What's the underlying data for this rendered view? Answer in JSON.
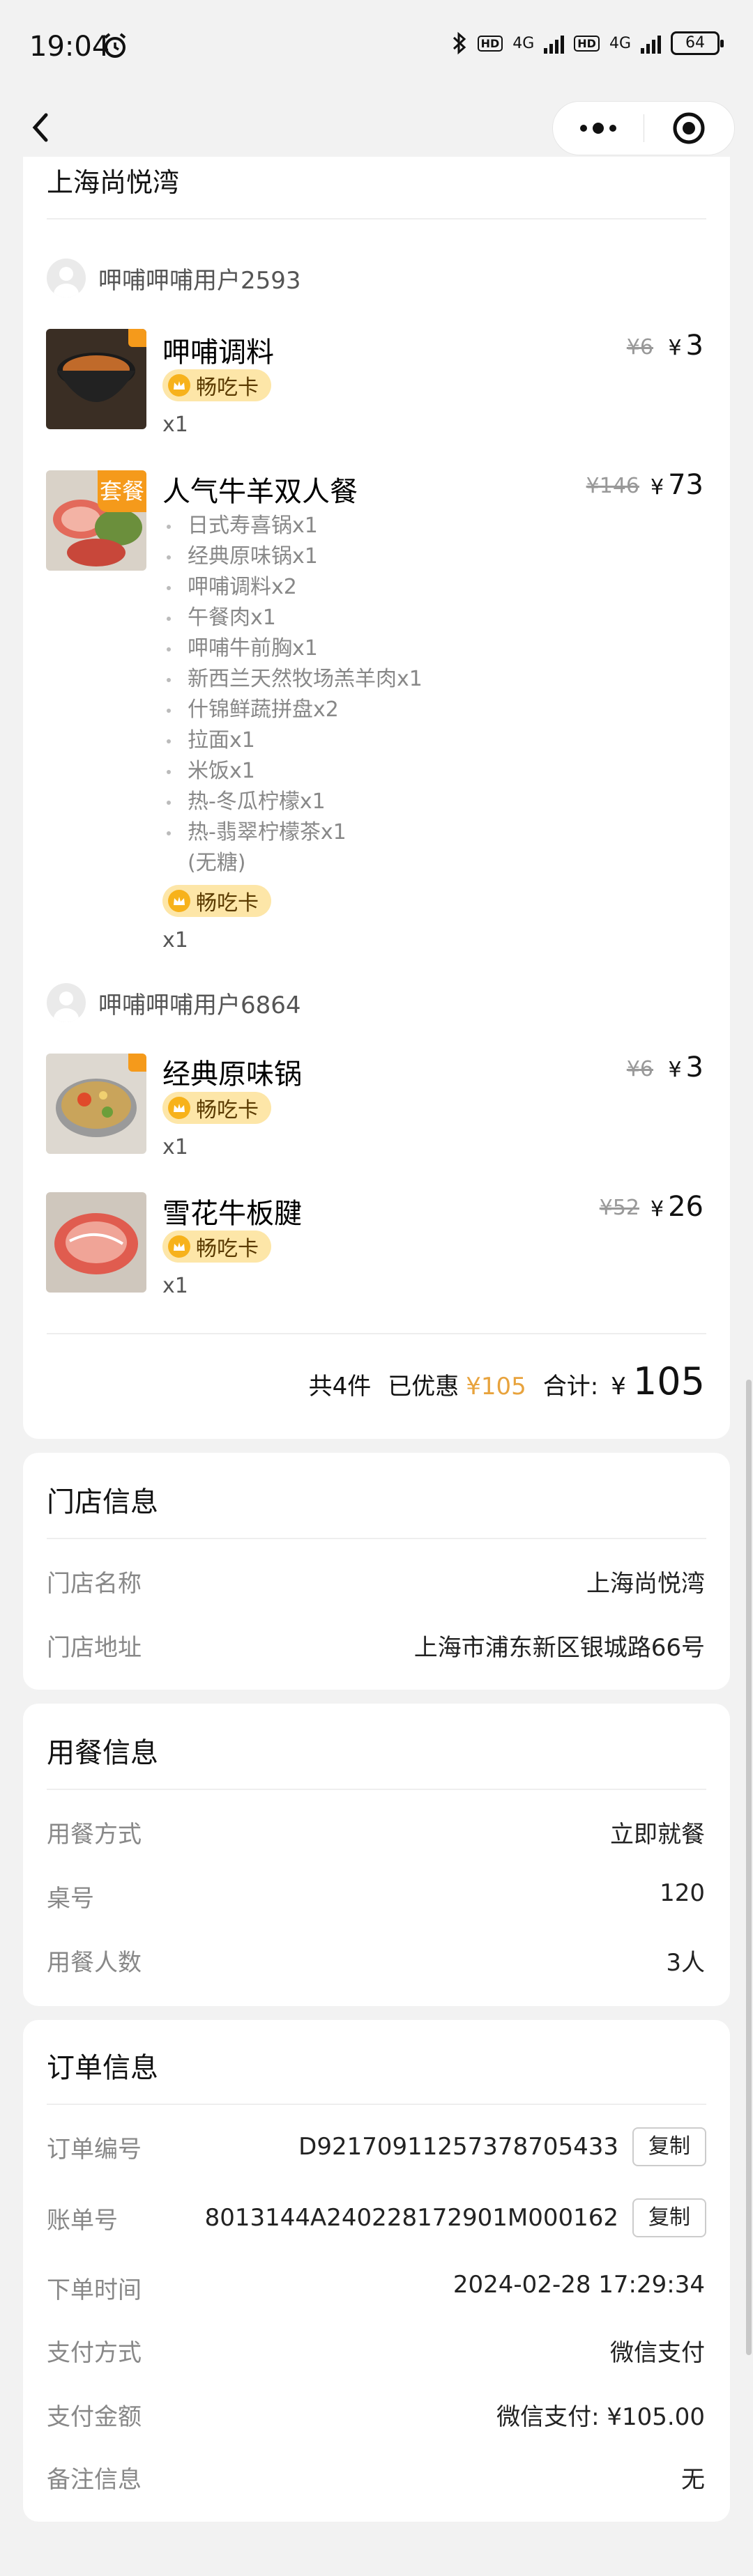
{
  "status": {
    "time": "19:04",
    "battery": "64",
    "net1": "4G",
    "net2": "4G",
    "hd": "HD"
  },
  "store": {
    "name": "上海尚悦湾"
  },
  "groups": [
    {
      "user": "呷哺呷哺用户2593",
      "items": [
        {
          "name": "呷哺调料",
          "card": "畅吃卡",
          "qty": "x1",
          "orig": "¥6",
          "price_symbol": "¥",
          "price": "3",
          "corner": ""
        },
        {
          "name": "人气牛羊双人餐",
          "card": "畅吃卡",
          "qty": "x1",
          "orig": "¥146",
          "price_symbol": "¥",
          "price": "73",
          "corner": "套餐",
          "sub": [
            "日式寿喜锅x1",
            "经典原味锅x1",
            "呷哺调料x2",
            "午餐肉x1",
            "呷哺牛前胸x1",
            "新西兰天然牧场羔羊肉x1",
            "什锦鲜蔬拼盘x2",
            "拉面x1",
            "米饭x1",
            "热-冬瓜柠檬x1",
            "热-翡翠柠檬茶x1",
            "(无糖)"
          ]
        }
      ]
    },
    {
      "user": "呷哺呷哺用户6864",
      "items": [
        {
          "name": "经典原味锅",
          "card": "畅吃卡",
          "qty": "x1",
          "orig": "¥6",
          "price_symbol": "¥",
          "price": "3",
          "corner": ""
        },
        {
          "name": "雪花牛板腱",
          "card": "畅吃卡",
          "qty": "x1",
          "orig": "¥52",
          "price_symbol": "¥",
          "price": "26",
          "corner": ""
        }
      ]
    }
  ],
  "summary": {
    "count": "共4件",
    "discount_label": "已优惠",
    "discount": "¥105",
    "total_label": "合计:",
    "total_symbol": "¥",
    "total": "105"
  },
  "store_info": {
    "title": "门店信息",
    "name_label": "门店名称",
    "name_value": "上海尚悦湾",
    "addr_label": "门店地址",
    "addr_value": "上海市浦东新区银城路66号"
  },
  "dining_info": {
    "title": "用餐信息",
    "mode_label": "用餐方式",
    "mode_value": "立即就餐",
    "table_label": "桌号",
    "table_value": "120",
    "people_label": "用餐人数",
    "people_value": "3人"
  },
  "order_info": {
    "title": "订单信息",
    "order_no_label": "订单编号",
    "order_no_value": "D921709112573787054​33",
    "bill_no_label": "账单号",
    "bill_no_value": "8013144A240228172901M000162",
    "copy": "复制",
    "time_label": "下单时间",
    "time_value": "2024-02-28 17:29:34",
    "pay_label": "支付方式",
    "pay_value": "微信支付",
    "amount_label": "支付金额",
    "amount_value": "微信支付: ¥105.00",
    "remark_label": "备注信息",
    "remark_value": "无"
  }
}
